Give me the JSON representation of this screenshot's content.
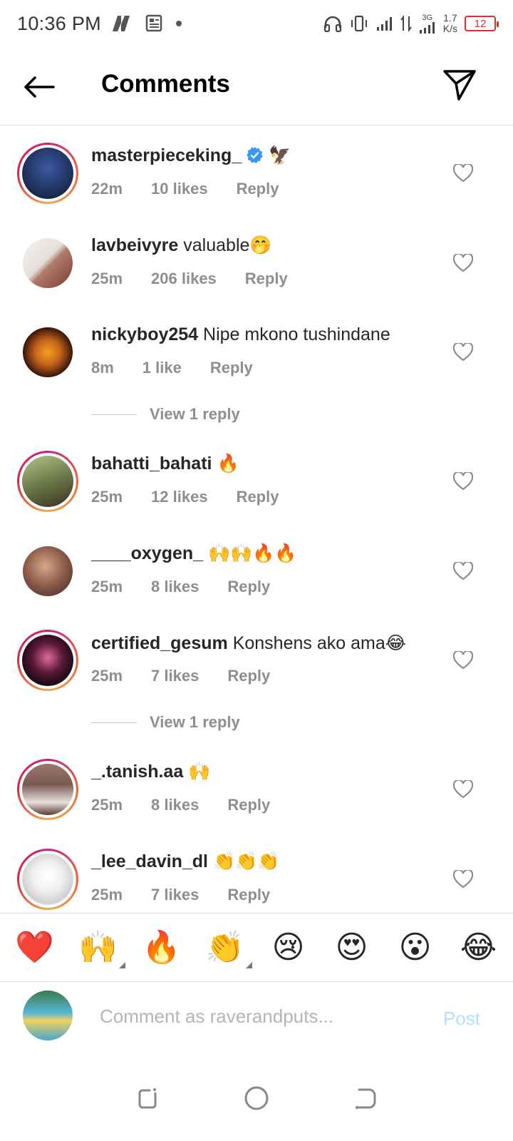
{
  "status_bar": {
    "time": "10:36 PM",
    "network": "3G",
    "speed_value": "1.7",
    "speed_unit": "K/s",
    "battery": "12"
  },
  "header": {
    "title": "Comments"
  },
  "comments": [
    {
      "username": "masterpieceking_",
      "verified": true,
      "text": "🦅",
      "time": "22m",
      "likes": "10 likes",
      "reply": "Reply",
      "story_ring": true,
      "avatar_color": "#1a2740"
    },
    {
      "username": "lavbeivyre",
      "verified": false,
      "text": "valuable🤭",
      "time": "25m",
      "likes": "206 likes",
      "reply": "Reply",
      "story_ring": false,
      "avatar_color": "#b07a6a"
    },
    {
      "username": "nickyboy254",
      "verified": false,
      "text": "Nipe mkono tushindane",
      "time": "8m",
      "likes": "1 like",
      "reply": "Reply",
      "story_ring": false,
      "avatar_color": "#c7661c",
      "view_replies": "View 1 reply"
    },
    {
      "username": "bahatti_bahati",
      "verified": false,
      "text": "🔥",
      "time": "25m",
      "likes": "12 likes",
      "reply": "Reply",
      "story_ring": true,
      "avatar_color": "#6b7a4a"
    },
    {
      "username": "____oxygen_",
      "verified": false,
      "text": "🙌🙌🔥🔥",
      "time": "25m",
      "likes": "8 likes",
      "reply": "Reply",
      "story_ring": false,
      "avatar_color": "#8a5a48"
    },
    {
      "username": "certified_gesum",
      "verified": false,
      "text": "Konshens ako ama😂",
      "time": "25m",
      "likes": "7 likes",
      "reply": "Reply",
      "story_ring": true,
      "avatar_color": "#2a1420",
      "view_replies": "View 1 reply"
    },
    {
      "username": "_.tanish.aa",
      "verified": false,
      "text": "🙌",
      "time": "25m",
      "likes": "8 likes",
      "reply": "Reply",
      "story_ring": true,
      "avatar_color": "#7a5a52"
    },
    {
      "username": "_lee_davin_dl",
      "verified": false,
      "text": "👏👏👏",
      "time": "25m",
      "likes": "7 likes",
      "reply": "Reply",
      "story_ring": true,
      "avatar_color": "#e8e8e8"
    }
  ],
  "emoji_bar": [
    "❤️",
    "🙌",
    "🔥",
    "👏",
    "😢",
    "😍",
    "😮",
    "😂"
  ],
  "input": {
    "placeholder": "Comment as raverandputs...",
    "post_label": "Post"
  },
  "colors": {
    "accent": "#0095f6",
    "post_disabled": "#b2dffc",
    "muted_text": "#8e8e8e",
    "battery_low": "#d32f2f"
  }
}
